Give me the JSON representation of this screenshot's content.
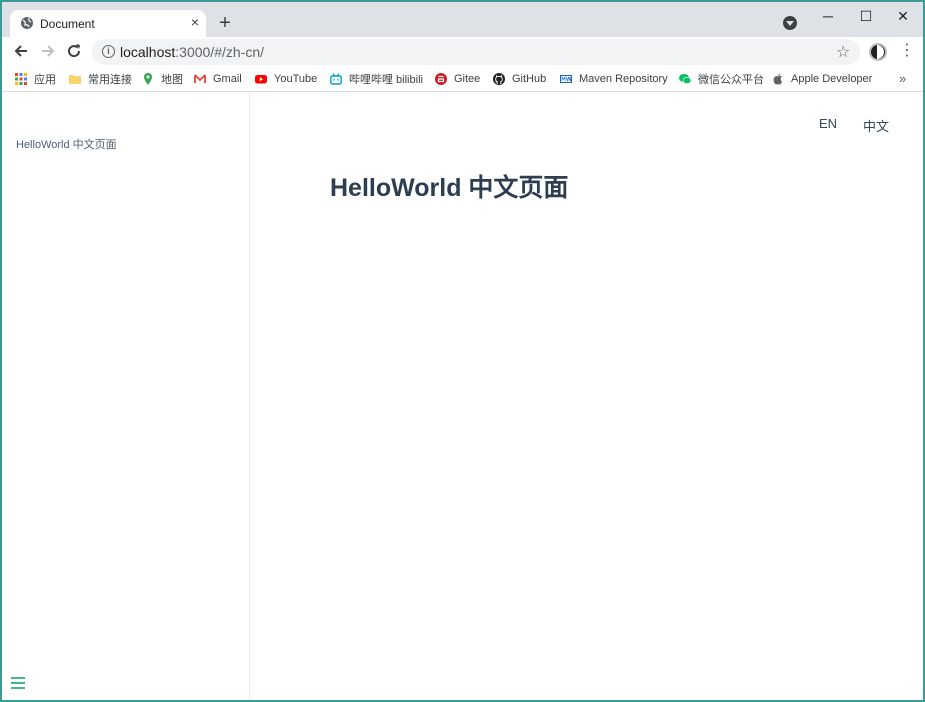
{
  "browser": {
    "tab": {
      "title": "Document",
      "favicon": "globe-icon",
      "close": "×"
    },
    "new_tab": "+",
    "window_controls": {
      "minimize": "─",
      "maximize": "☐",
      "close": "✕"
    },
    "url": {
      "host": "localhost",
      "path": ":3000/#/zh-cn/"
    }
  },
  "bookmarks": [
    {
      "label": "应用",
      "icon": "apps-grid-icon",
      "color": "#ea4335"
    },
    {
      "label": "常用连接",
      "icon": "folder-icon",
      "color": "#f9d46b"
    },
    {
      "label": "地图",
      "icon": "maps-pin-icon",
      "color": "#34a853"
    },
    {
      "label": "Gmail",
      "icon": "gmail-icon",
      "color": "#ea4335"
    },
    {
      "label": "YouTube",
      "icon": "youtube-icon",
      "color": "#ff0000"
    },
    {
      "label": "哔哩哔哩 bilibili",
      "icon": "bilibili-icon",
      "color": "#00a1d6"
    },
    {
      "label": "Gitee",
      "icon": "gitee-icon",
      "color": "#c71d23"
    },
    {
      "label": "GitHub",
      "icon": "github-icon",
      "color": "#202124"
    },
    {
      "label": "Maven Repository",
      "icon": "maven-icon",
      "color": "#1565c0"
    },
    {
      "label": "微信公众平台",
      "icon": "wechat-icon",
      "color": "#07c160"
    },
    {
      "label": "Apple Developer",
      "icon": "apple-icon",
      "color": "#5f6368"
    }
  ],
  "bookmarks_more": "»",
  "sidebar": {
    "link": "HelloWorld 中文页面",
    "toggle_color": "#42b983"
  },
  "nav": {
    "en": "EN",
    "zh": "中文"
  },
  "content": {
    "heading": "HelloWorld 中文页面"
  }
}
